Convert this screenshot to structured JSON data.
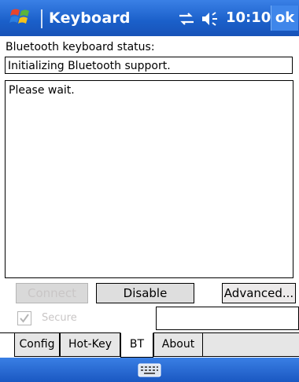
{
  "titlebar": {
    "title": "Keyboard",
    "time": "10:10",
    "ok_label": "ok",
    "icons": [
      "windows-start-icon",
      "connectivity-icon",
      "volume-icon"
    ]
  },
  "bt": {
    "status_label": "Bluetooth keyboard status:",
    "status_value": "Initializing Bluetooth support.",
    "log_text": "Please wait.",
    "buttons": {
      "connect": "Connect",
      "disable": "Disable",
      "advanced": "Advanced..."
    },
    "secure_label": "Secure",
    "secure_checked": true,
    "secure_value": ""
  },
  "tabs": [
    {
      "label": "Config"
    },
    {
      "label": "Hot-Key"
    },
    {
      "label": "BT",
      "active": true
    },
    {
      "label": "About"
    }
  ],
  "bottombar": {
    "icon": "keyboard-icon"
  },
  "colors": {
    "titlebar": "#1a5fc9",
    "disabled_text": "#c9c6c6",
    "tab_inactive": "#e6e6e6"
  }
}
